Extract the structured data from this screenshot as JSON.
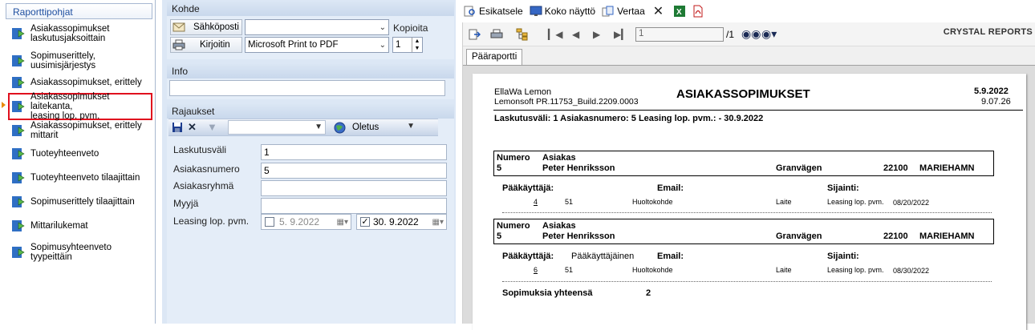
{
  "left": {
    "header": "Raporttipohjat",
    "items": [
      {
        "line1": "Asiakassopimukset",
        "line2": "laskutusjaksoittain"
      },
      {
        "line1": "Sopimuserittely, uusimisjärjestys",
        "line2": ""
      },
      {
        "line1": "Asiakassopimukset, erittely",
        "line2": ""
      },
      {
        "line1": "Asiakassopimukset laitekanta,",
        "line2": "leasing lop. pvm."
      },
      {
        "line1": "Asiakassopimukset, erittely",
        "line2": "mittarit"
      },
      {
        "line1": "Tuoteyhteenveto",
        "line2": ""
      },
      {
        "line1": "Tuoteyhteenveto tilaajittain",
        "line2": ""
      },
      {
        "line1": "Sopimuserittely tilaajittain",
        "line2": ""
      },
      {
        "line1": "Mittarilukemat",
        "line2": ""
      },
      {
        "line1": "Sopimusyhteenveto tyypeittäin",
        "line2": ""
      }
    ]
  },
  "kohde": {
    "title": "Kohde",
    "email_label": "Sähköposti",
    "printer_label": "Kirjoitin",
    "email_value": "",
    "printer_value": "Microsoft Print to PDF",
    "copies_label": "Kopioita",
    "copies_value": "1"
  },
  "info": {
    "title": "Info",
    "value": ""
  },
  "rajaukset": {
    "title": "Rajaukset",
    "filter_value": "",
    "preset_value": "Oletus",
    "fields": [
      {
        "label": "Laskutusväli",
        "value": "1"
      },
      {
        "label": "Asiakasnumero",
        "value": "5"
      },
      {
        "label": "Asiakasryhmä",
        "value": ""
      },
      {
        "label": "Myyjä",
        "value": ""
      }
    ],
    "leasing_label": "Leasing lop. pvm.",
    "date_from": "5. 9.2022",
    "date_to": "30. 9.2022",
    "date_from_checked": false,
    "date_to_checked": true
  },
  "toolbar": {
    "preview": "Esikatsele",
    "fullscreen": "Koko näyttö",
    "compare": "Vertaa"
  },
  "viewer": {
    "page_current": "1",
    "page_total": "/1",
    "brand": "CRYSTAL REPORTS",
    "tab": "Pääraportti"
  },
  "report": {
    "company": "EllaWa Lemon",
    "build": "Lemonsoft PR.11753_Build.2209.0003",
    "title": "ASIAKASSOPIMUKSET",
    "date": "5.9.2022",
    "time": "9.07.26",
    "criteria": "Laskutusväli: 1 Asiakasnumero: 5 Leasing lop. pvm.: - 30.9.2022",
    "hdr_numero": "Numero",
    "hdr_asiakas": "Asiakas",
    "hdr_paakayttaja": "Pääkäyttäjä:",
    "hdr_email": "Email:",
    "hdr_sijainti": "Sijainti:",
    "blocks": [
      {
        "numero": "5",
        "asiakas": "Peter Henriksson",
        "street": "Granvägen",
        "zip": "22100",
        "city": "MARIEHAMN",
        "paakayttaja": "",
        "row": {
          "no": "4",
          "id": "51",
          "kohde": "Huoltokohde",
          "laite": "Laite",
          "lbl": "Leasing lop. pvm.",
          "date": "08/20/2022"
        }
      },
      {
        "numero": "5",
        "asiakas": "Peter Henriksson",
        "street": "Granvägen",
        "zip": "22100",
        "city": "MARIEHAMN",
        "paakayttaja": "Pääkäyttäjäinen",
        "row": {
          "no": "6",
          "id": "51",
          "kohde": "Huoltokohde",
          "laite": "Laite",
          "lbl": "Leasing lop. pvm.",
          "date": "08/30/2022"
        }
      }
    ],
    "total_label": "Sopimuksia yhteensä",
    "total_value": "2"
  }
}
